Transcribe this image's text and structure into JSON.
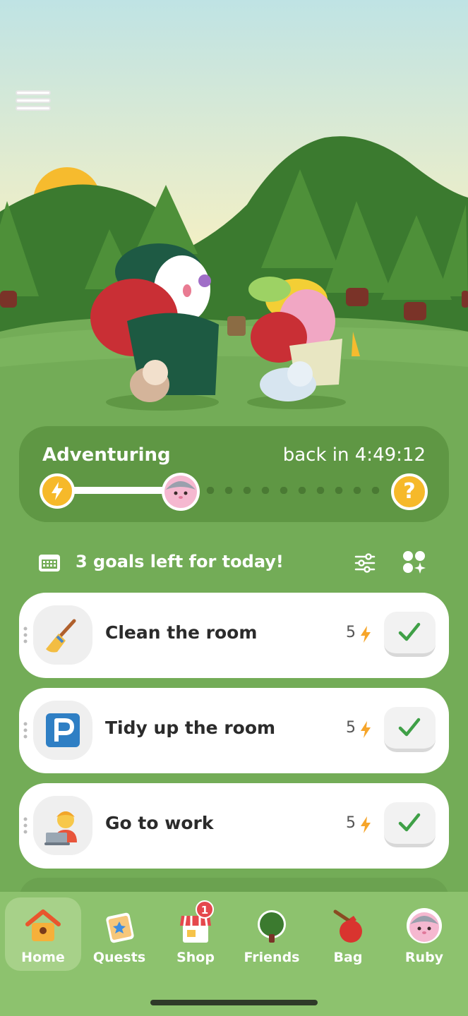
{
  "adventure": {
    "status": "Adventuring",
    "return_time": "back in 4:49:12",
    "progress": 0.4,
    "end_marker": "?"
  },
  "goals": {
    "header": "3 goals left for today!",
    "items": [
      {
        "label": "Clean the room",
        "points": "5",
        "icon": "broom-icon"
      },
      {
        "label": "Tidy up the room",
        "points": "5",
        "icon": "parking-icon"
      },
      {
        "label": "Go to work",
        "points": "5",
        "icon": "worker-laptop-icon"
      }
    ]
  },
  "nav": {
    "items": [
      {
        "label": "Home",
        "icon": "home-icon",
        "active": true
      },
      {
        "label": "Quests",
        "icon": "quests-icon"
      },
      {
        "label": "Shop",
        "icon": "shop-icon",
        "badge": "1"
      },
      {
        "label": "Friends",
        "icon": "tree-icon"
      },
      {
        "label": "Bag",
        "icon": "bag-icon"
      },
      {
        "label": "Ruby",
        "icon": "ruby-avatar-icon"
      }
    ]
  },
  "colors": {
    "background": "#73ac57",
    "accent": "#f6b92a",
    "check": "#3fa047",
    "badge": "#e5484d"
  }
}
